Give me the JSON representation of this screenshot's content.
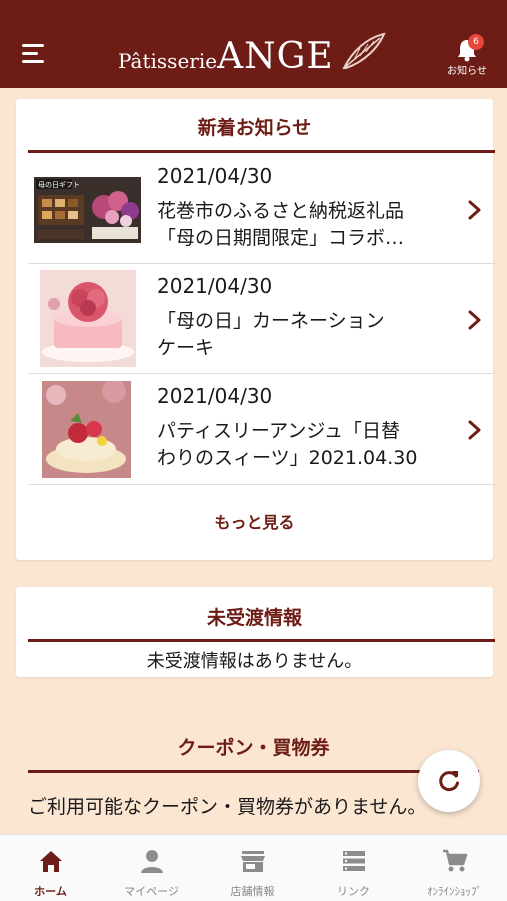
{
  "header": {
    "logo_prefix": "Pâtisserie",
    "logo_main": "ANGE",
    "notification_count": "6",
    "notification_label": "お知らせ"
  },
  "news": {
    "title": "新着お知らせ",
    "items": [
      {
        "date": "2021/04/30",
        "text": "花巻市のふるさと納税返礼品\n「母の日期間限定」コラボ…",
        "icon": "gift-box-photo"
      },
      {
        "date": "2021/04/30",
        "text": "「母の日」カーネーション\nケーキ",
        "icon": "carnation-cake-photo"
      },
      {
        "date": "2021/04/30",
        "text": "パティスリーアンジュ「日替\nわりのスィーツ」2021.04.30",
        "icon": "sweets-photo"
      }
    ],
    "more_label": "もっと見る"
  },
  "pending": {
    "title": "未受渡情報",
    "message": "未受渡情報はありません。"
  },
  "coupon": {
    "title": "クーポン・買物券",
    "message": "ご利用可能なクーポン・買物券がありません。"
  },
  "bottom_nav": [
    {
      "label": "ホーム",
      "icon": "home-icon",
      "active": true
    },
    {
      "label": "マイページ",
      "icon": "person-icon",
      "active": false
    },
    {
      "label": "店舗情報",
      "icon": "store-icon",
      "active": false
    },
    {
      "label": "リンク",
      "icon": "list-icon",
      "active": false
    },
    {
      "label": "ｵﾝﾗｲﾝｼｮｯﾌﾟ",
      "icon": "cart-icon",
      "active": false
    }
  ],
  "colors": {
    "brand": "#6e1d16",
    "background": "#fbe6d2",
    "badge": "#e8473b"
  }
}
